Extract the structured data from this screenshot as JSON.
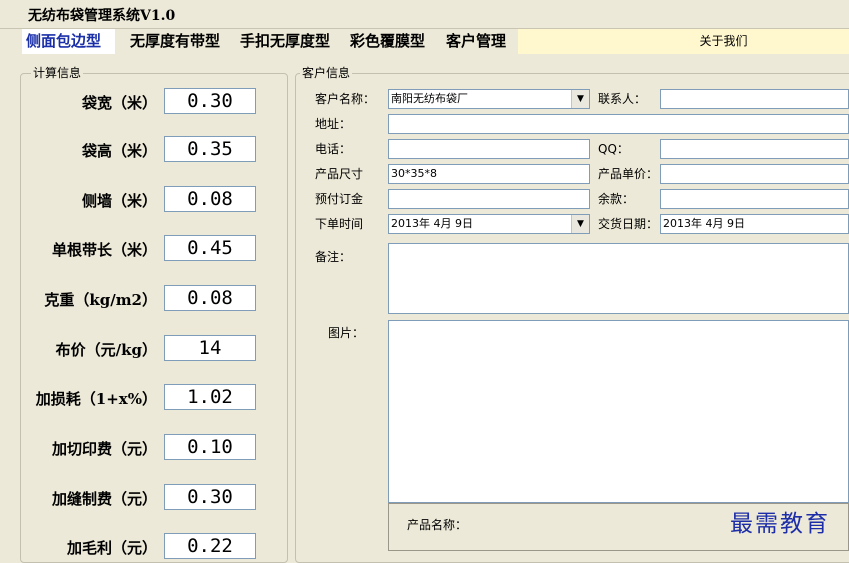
{
  "window": {
    "title": "无纺布袋管理系统V1.0"
  },
  "tabs": [
    {
      "label": "侧面包边型",
      "active": true
    },
    {
      "label": "无厚度有带型",
      "active": false
    },
    {
      "label": "手扣无厚度型",
      "active": false
    },
    {
      "label": "彩色覆膜型",
      "active": false
    },
    {
      "label": "客户管理",
      "active": false
    }
  ],
  "about_label": "关于我们",
  "calc": {
    "legend": "计算信息",
    "rows": [
      {
        "label": "袋宽（米）",
        "value": "0.30"
      },
      {
        "label": "袋高（米）",
        "value": "0.35"
      },
      {
        "label": "侧墙（米）",
        "value": "0.08"
      },
      {
        "label": "单根带长（米）",
        "value": "0.45"
      },
      {
        "label": "克重（kg/m2）",
        "value": "0.08"
      },
      {
        "label": "布价（元/kg）",
        "value": "14"
      },
      {
        "label": "加损耗（1+x%）",
        "value": "1.02"
      },
      {
        "label": "加切印费（元）",
        "value": "0.10"
      },
      {
        "label": "加缝制费（元）",
        "value": "0.30"
      },
      {
        "label": "加毛利（元）",
        "value": "0.22"
      }
    ]
  },
  "customer": {
    "legend": "客户信息",
    "name_label": "客户名称：",
    "name_value": "南阳无纺布袋厂",
    "contact_label": "联系人：",
    "contact_value": "",
    "address_label": "地址：",
    "address_value": "",
    "phone_label": "电话：",
    "phone_value": "",
    "qq_label": "QQ：",
    "qq_value": "",
    "size_label": "产品尺寸",
    "size_value": "30*35*8",
    "unit_price_label": "产品单价：",
    "unit_price_value": "",
    "deposit_label": "预付订金",
    "deposit_value": "",
    "balance_label": "余款：",
    "balance_value": "",
    "order_time_label": "下单时间",
    "order_time_value": "2013年 4月 9日",
    "delivery_label": "交货日期：",
    "delivery_value": "2013年 4月 9日",
    "remarks_label": "备注：",
    "image_label": "图片："
  },
  "bottom_panel": {
    "product_name_label": "产品名称："
  },
  "watermark": "最需教育",
  "colors": {
    "active_tab_text": "#1a2fa8",
    "tab_fill": "#fff8cf",
    "window_bg": "#ece9d8"
  }
}
